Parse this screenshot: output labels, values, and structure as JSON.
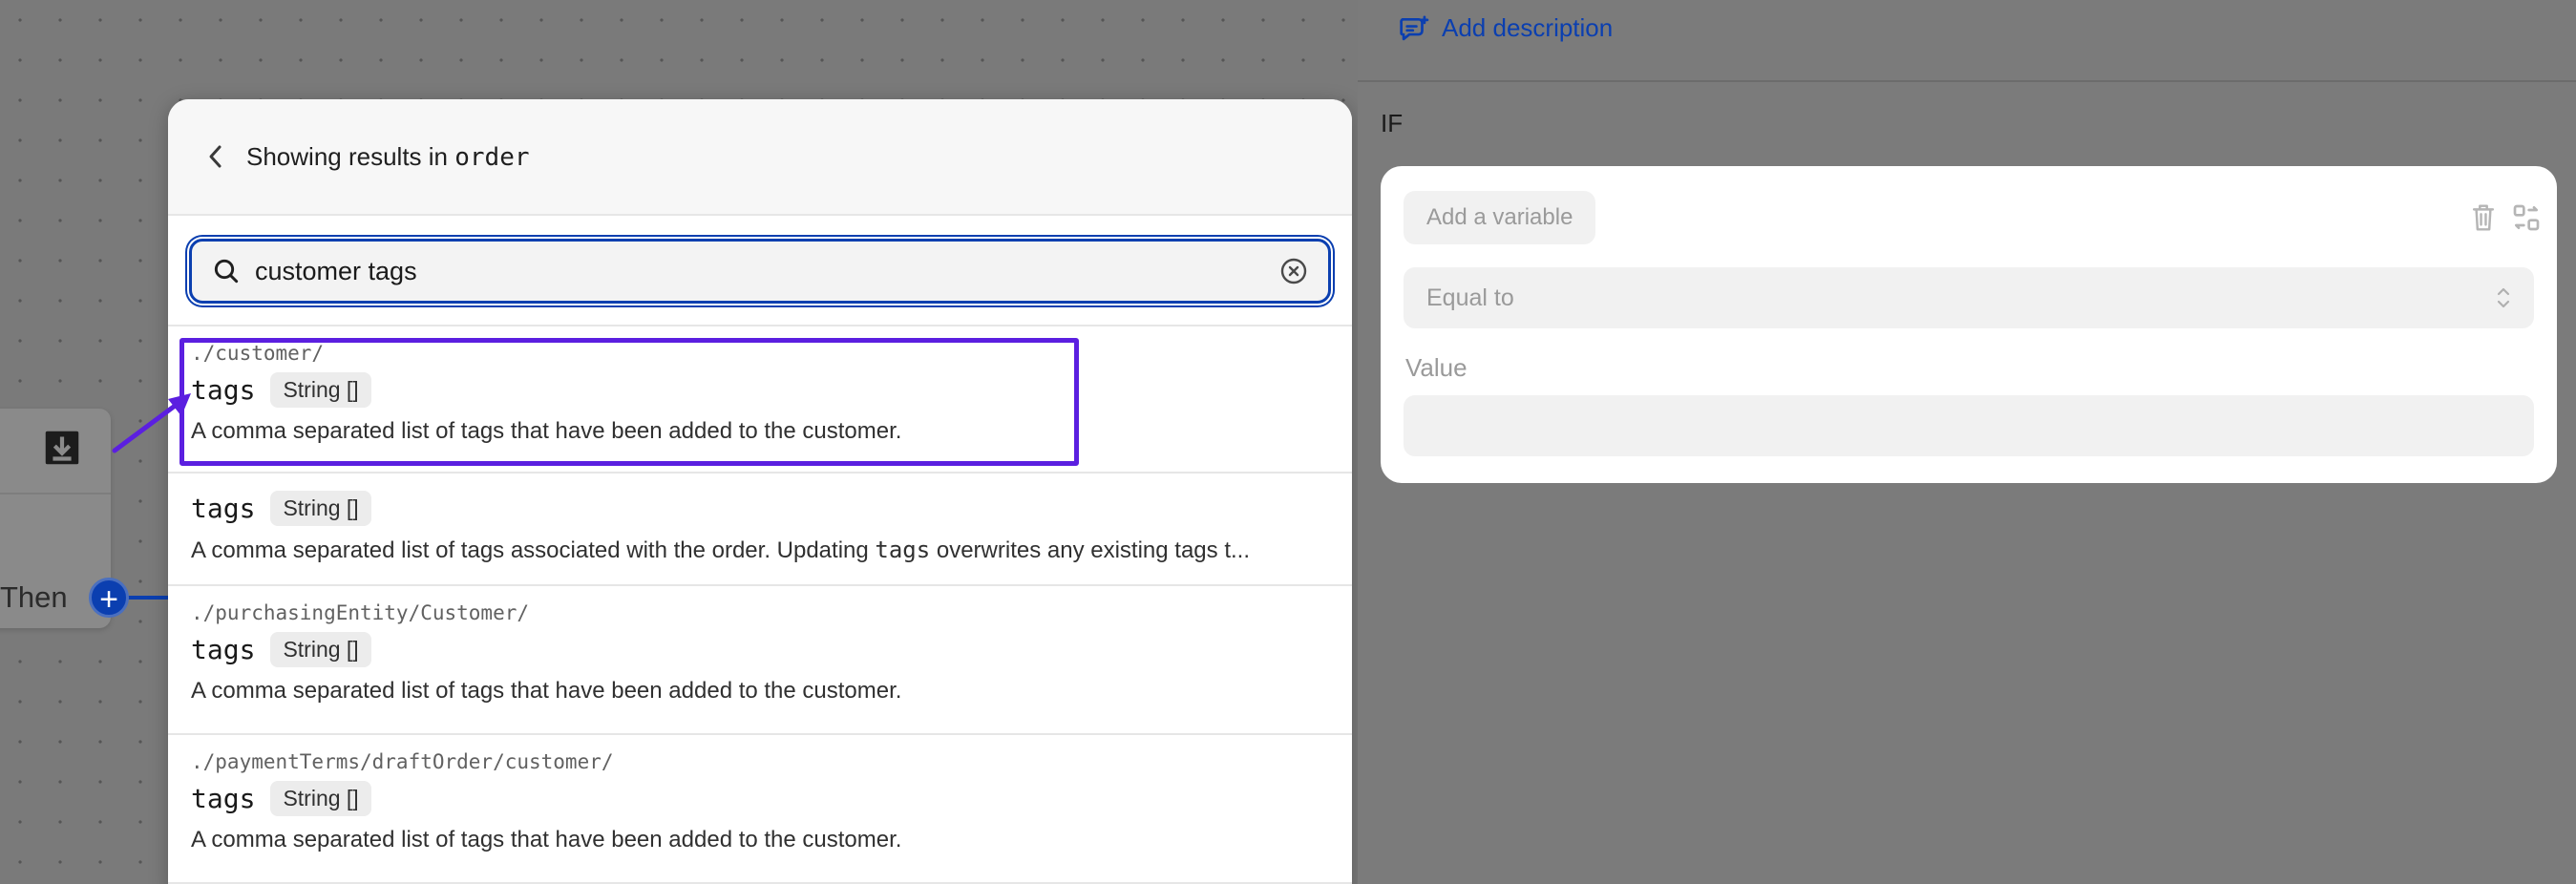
{
  "canvas": {
    "then_label": "Then",
    "plus_glyph": "+"
  },
  "dialog": {
    "header_prefix": "Showing results in ",
    "header_scope": "order",
    "search": {
      "value": "customer tags",
      "placeholder": ""
    },
    "results": [
      {
        "path": "./customer/",
        "name": "tags",
        "type": "String []",
        "description": "A comma separated list of tags that have been added to the customer."
      },
      {
        "path": "",
        "name": "tags",
        "type": "String []",
        "description_before": "A comma separated list of tags associated with the order. Updating ",
        "description_code": "tags",
        "description_after": " overwrites any existing tags t..."
      },
      {
        "path": "./purchasingEntity/Customer/",
        "name": "tags",
        "type": "String []",
        "description": "A comma separated list of tags that have been added to the customer."
      },
      {
        "path": "./paymentTerms/draftOrder/customer/",
        "name": "tags",
        "type": "String []",
        "description": "A comma separated list of tags that have been added to the customer."
      }
    ]
  },
  "panel": {
    "add_description": "Add description",
    "if_label": "IF",
    "add_variable": "Add a variable",
    "operator": "Equal to",
    "value_label": "Value",
    "value": ""
  },
  "colors": {
    "accent": "#0b3fb0",
    "highlight": "#5b1fe0"
  },
  "icons": [
    "chevron-left-icon",
    "search-icon",
    "clear-icon",
    "comment-icon",
    "trash-icon",
    "swap-icon",
    "select-chevron-icon",
    "download-icon",
    "arrow-annotation"
  ]
}
